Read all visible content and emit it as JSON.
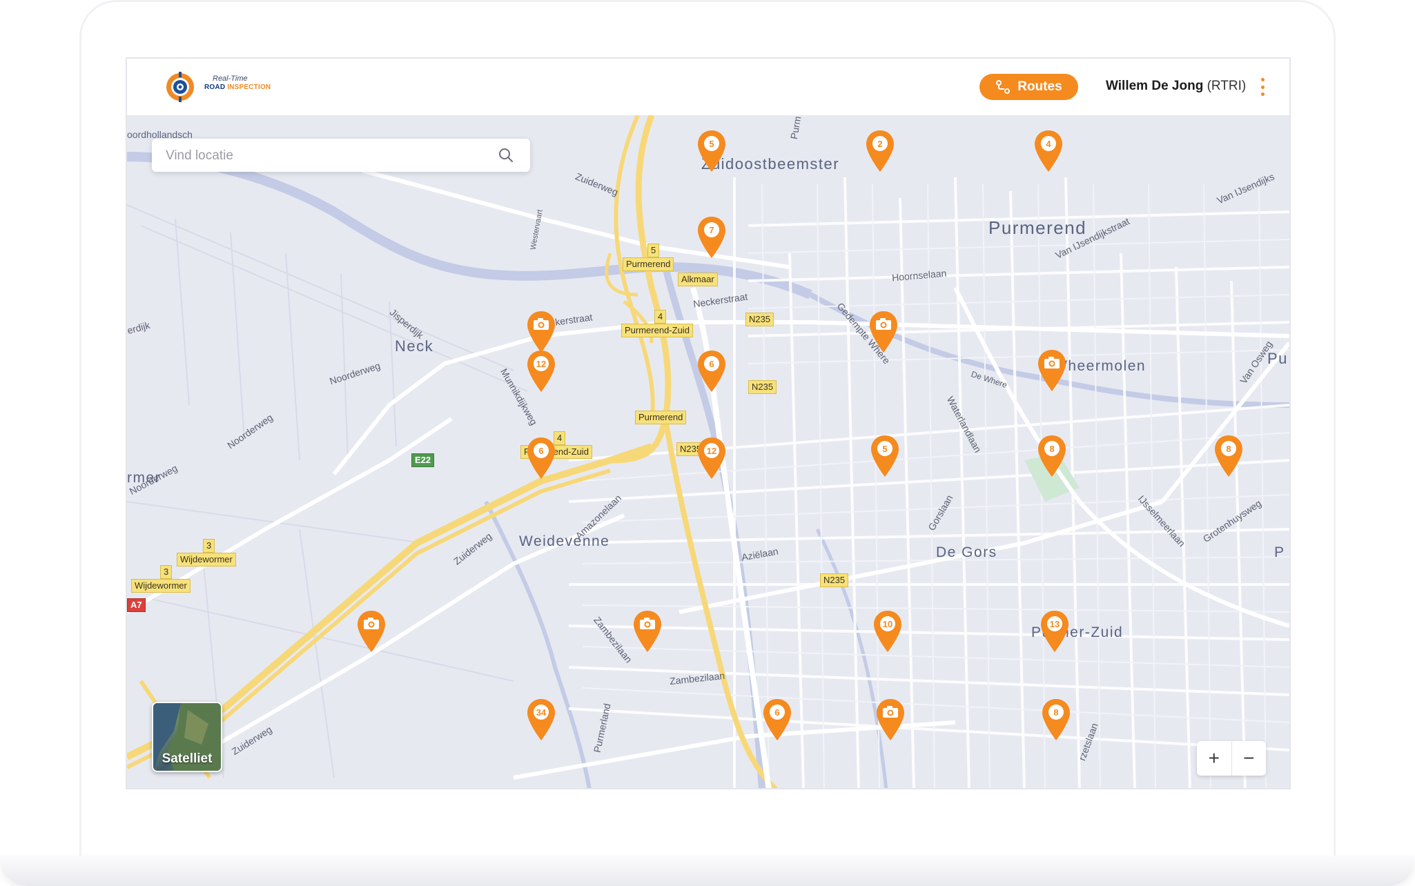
{
  "header": {
    "logo_text_top": "Real-Time",
    "logo_text_bottom_a": "ROAD",
    "logo_text_bottom_b": "INSPECTION",
    "routes_label": "Routes",
    "user_name": "Willem De Jong",
    "user_role": "(RTRI)"
  },
  "search": {
    "placeholder": "Vind locatie"
  },
  "map": {
    "places": {
      "zuidoostbeemster": "Zuidoostbeemster",
      "purmerend": "Purmerend",
      "neck": "Neck",
      "wheermolen": "Wheermolen",
      "weidevenne": "Weidevenne",
      "de_gors": "De Gors",
      "purmer_zuid": "Purmer-Zuid",
      "wormer": "rmer",
      "pu": "Pu",
      "p": "P",
      "noordhollandsch": "oordhollandsch"
    },
    "roads": {
      "zuiderweg_top": "Zuiderweg",
      "westerweg": "Westervaart",
      "neckerstraat": "Neckerstraat",
      "kerstraat": "kerstraat",
      "jisperdijk": "Jisperdijk",
      "noorderweg_1": "Noorderweg",
      "noorderweg_2": "Noorderweg",
      "noorderweg_3": "Noorderweg",
      "erdijk": "erdijk",
      "munnikdijkweg": "Munnikdijkweg",
      "hoornselaan": "Hoornselaan",
      "gedempte_where": "Gedempte Where",
      "de_where": "De Where",
      "waterlandlaan": "Waterlandlaan",
      "van_ijsendijkstraat": "Van IJsendijkstraat",
      "van_ijsendijks": "Van IJsendijks",
      "van_osweg": "Van Osweg",
      "amazonelaan": "Amazonelaan",
      "azielaan": "Aziëlaan",
      "gorslaan": "Gorslaan",
      "ijsselmeerlaan": "IJsselmeerlaan",
      "grotenhuysweg": "Grotenhuysweg",
      "zuiderweg_mid": "Zuiderweg",
      "zuiderweg_bottom": "Zuiderweg",
      "zambezilaan_1": "Zambezilaan",
      "zambezilaan_2": "Zambezilaan",
      "purmerland": "Purmerland",
      "rzetslaan": "rzetslaan",
      "purm_top": "Purm"
    },
    "shields": {
      "exit5": "5",
      "purmerend_a": "Purmerend",
      "alkmaar": "Alkmaar",
      "exit4a": "4",
      "purmerend_zuid_a": "Purmerend-Zuid",
      "n235_a": "N235",
      "n235_b": "N235",
      "purmerend_b": "Purmerend",
      "exit4b": "4",
      "purmerend_zuid_b": "Purmerend-Zuid",
      "n235_c": "N235",
      "e22": "E22",
      "exit3a": "3",
      "wijdewormer_a": "Wijdewormer",
      "exit3b": "3",
      "wijdewormer_b": "Wijdewormer",
      "a7": "A7",
      "n235_d": "N235"
    },
    "markers": {
      "m1": "5",
      "m2": "2",
      "m3": "4",
      "m4": "7",
      "m5": "12",
      "m6": "6",
      "m7": "6",
      "m8": "12",
      "m9": "5",
      "m10": "8",
      "m11": "8",
      "m12": "10",
      "m13": "13",
      "m14": "34",
      "m15": "6",
      "m16": "8"
    },
    "satellite_label": "Satelliet",
    "zoom_in": "+",
    "zoom_out": "−"
  },
  "colors": {
    "accent": "#f58a1f",
    "map_bg": "#e7e9f1",
    "water": "#c3cbe6",
    "highway": "#f7d878"
  }
}
